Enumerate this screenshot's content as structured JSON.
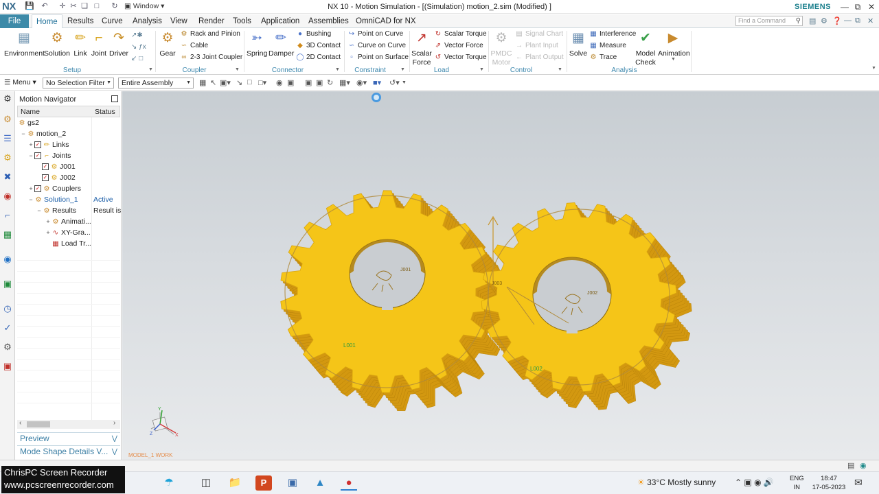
{
  "app": {
    "logo": "NX",
    "window_menu": "Window",
    "title": "NX 10 - Motion Simulation - [(Simulation) motion_2.sim (Modified) ]",
    "brand": "SIEMENS"
  },
  "tabs": [
    "File",
    "Home",
    "Results",
    "Curve",
    "Analysis",
    "View",
    "Render",
    "Tools",
    "Application",
    "Assemblies",
    "OmniCAD for NX"
  ],
  "active_tab": "Home",
  "search": {
    "placeholder": "Find a Command"
  },
  "ribbon": {
    "setup": {
      "group": "Setup",
      "environment": "Environment",
      "solution": "Solution",
      "link": "Link",
      "joint": "Joint",
      "driver": "Driver"
    },
    "coupler": {
      "group": "Coupler",
      "gear": "Gear",
      "rack_and_pinion": "Rack and Pinion",
      "cable": "Cable",
      "joint_coupler": "2-3 Joint Coupler"
    },
    "connector": {
      "group": "Connector",
      "spring": "Spring",
      "damper": "Damper",
      "bushing": "Bushing",
      "contact_3d": "3D Contact",
      "contact_2d": "2D Contact"
    },
    "constraint": {
      "group": "Constraint",
      "point_on_curve": "Point on Curve",
      "curve_on_curve": "Curve on Curve",
      "point_on_surface": "Point on Surface"
    },
    "load": {
      "group": "Load",
      "scalar_force_1": "Scalar",
      "scalar_force_2": "Force",
      "scalar_torque": "Scalar Torque",
      "vector_force": "Vector Force",
      "vector_torque": "Vector Torque"
    },
    "control": {
      "group": "Control",
      "pmdc_1": "PMDC",
      "pmdc_2": "Motor",
      "signal_chart": "Signal Chart",
      "plant_input": "Plant Input",
      "plant_output": "Plant Output"
    },
    "analysis": {
      "group": "Analysis",
      "solve": "Solve",
      "interference": "Interference",
      "measure": "Measure",
      "trace": "Trace",
      "model_check_1": "Model",
      "model_check_2": "Check",
      "animation": "Animation"
    }
  },
  "toolbar": {
    "menu": "Menu",
    "selection_filter": "No Selection Filter",
    "scope": "Entire Assembly"
  },
  "navigator": {
    "title": "Motion Navigator",
    "columns": {
      "name": "Name",
      "status": "Status"
    },
    "rows": [
      {
        "label": "gs2",
        "status": ""
      },
      {
        "label": "motion_2",
        "status": ""
      },
      {
        "label": "Links",
        "status": ""
      },
      {
        "label": "Joints",
        "status": ""
      },
      {
        "label": "J001",
        "status": ""
      },
      {
        "label": "J002",
        "status": ""
      },
      {
        "label": "Couplers",
        "status": ""
      },
      {
        "label": "Solution_1",
        "status": "Active"
      },
      {
        "label": "Results",
        "status": "Result is"
      },
      {
        "label": "Animati...",
        "status": ""
      },
      {
        "label": "XY-Gra...",
        "status": ""
      },
      {
        "label": "Load Tr...",
        "status": ""
      }
    ],
    "panels": {
      "preview": "Preview",
      "mode_shape": "Mode Shape Details V..."
    }
  },
  "viewport": {
    "part_labels": {
      "link1": "L001",
      "link2": "L002"
    },
    "joint_labels": {
      "j1": "J001",
      "j2": "J002",
      "marker": "J003"
    },
    "triad": {
      "x": "X",
      "y": "Y",
      "z": "Z"
    },
    "wcs_text": "MODEL_1 WORK",
    "gear_color": "#f5c518",
    "gear_side_color": "#d39810"
  },
  "taskbar": {
    "weather": "33°C  Mostly sunny",
    "lang_1": "ENG",
    "lang_2": "IN",
    "time": "18:47",
    "date": "17-05-2023"
  },
  "recorder": {
    "line1": "ChrisPC Screen Recorder",
    "line2": "www.pcscreenrecorder.com"
  }
}
